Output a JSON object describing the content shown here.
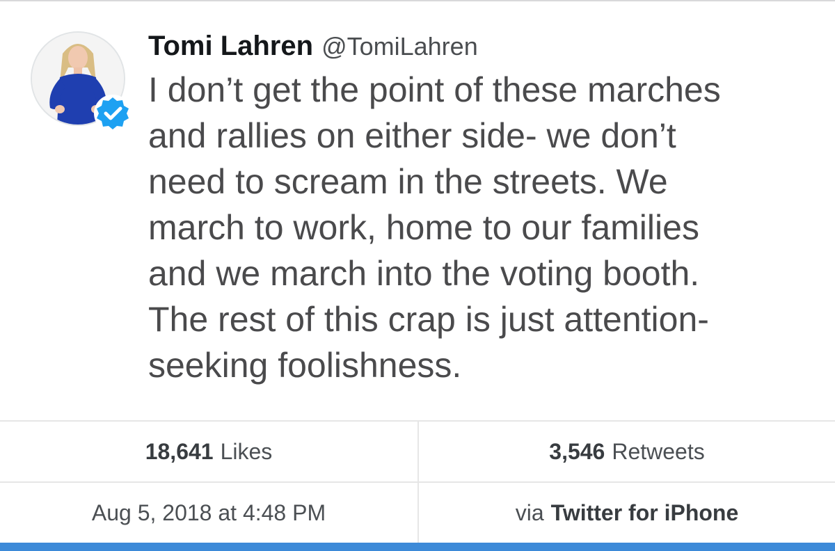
{
  "tweet": {
    "display_name": "Tomi Lahren",
    "handle": "@TomiLahren",
    "verified": true,
    "text_lines": [
      "I don’t get the point of these marches",
      "and rallies on either side- we don’t",
      "need to scream in the streets. We",
      "march to work, home to our families",
      "and we march into the voting booth.",
      "The rest of this crap is just attention-",
      "seeking foolishness."
    ]
  },
  "stats": {
    "likes_count": "18,641",
    "likes_label": "Likes",
    "retweets_count": "3,546",
    "retweets_label": "Retweets"
  },
  "meta": {
    "timestamp": "Aug 5, 2018 at 4:48 PM",
    "via_prefix": "via",
    "source_app": "Twitter for iPhone"
  },
  "colors": {
    "verified_badge": "#1da1f2",
    "bottom_bar": "#3d8ad8"
  }
}
